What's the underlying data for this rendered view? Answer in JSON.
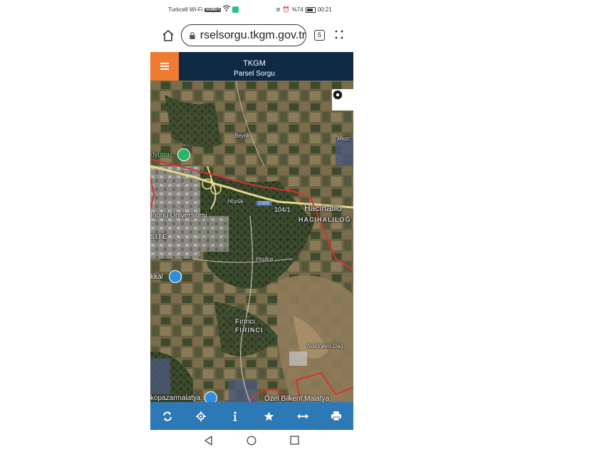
{
  "status_bar": {
    "carrier": "Turkcell Wi-Fi",
    "carrier_badge": "VoWiFi",
    "battery": "%74",
    "time": "00:21"
  },
  "browser": {
    "url": "rselsorgu.tkgm.gov.tr",
    "tab_count": "5"
  },
  "app": {
    "title": "TKGM",
    "subtitle": "Parsel Sorgu"
  },
  "map": {
    "labels": {
      "beylik": "Beylik",
      "mezr": "Mezr",
      "oyumu": "dyumu",
      "inonu": "İnönü Üniversitesi",
      "site": "SITE",
      "hoyuk": "Höyük",
      "d300": "D300",
      "road_104": "104/1",
      "hacihalil": "Hacıhalilo",
      "hacihalil_caps": "HACIHALILOĞ",
      "yesilce": "Yeşilce",
      "bakkal": "kkal",
      "firinci": "Fırıncı",
      "firinci_caps": "FIRINCI",
      "naldoken": "Naldöken Dağ",
      "kopazar": "kopazarmalatya",
      "bilkent": "Özel Bilkent Malatya"
    }
  },
  "toolbar": {
    "items": [
      "refresh",
      "locate",
      "info",
      "favorite",
      "measure",
      "print"
    ]
  },
  "colors": {
    "header_bg": "#0f2a45",
    "menu_orange": "#ef7a31",
    "toolbar_blue": "#2d79b5",
    "parcel_red": "#d8332c"
  }
}
